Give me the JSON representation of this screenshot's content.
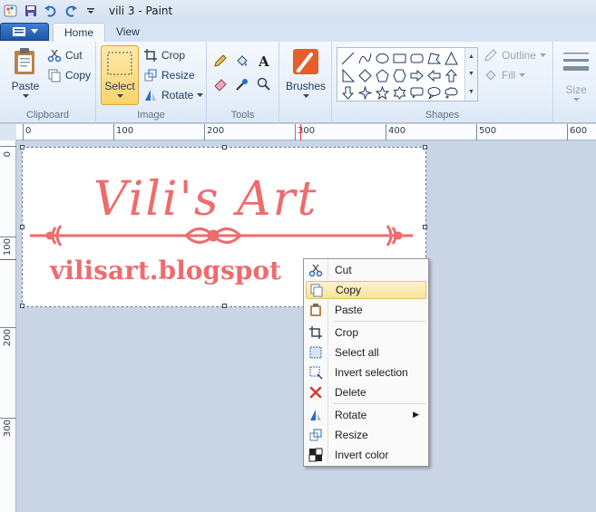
{
  "window": {
    "title": "vili 3 - Paint",
    "qat_icons": [
      "paint-app-icon",
      "save-icon",
      "undo-icon",
      "redo-icon",
      "customize-qat-icon"
    ]
  },
  "tabs": [
    {
      "label": "Home",
      "active": true
    },
    {
      "label": "View",
      "active": false
    }
  ],
  "ribbon": {
    "clipboard": {
      "group_label": "Clipboard",
      "paste_label": "Paste",
      "cut_label": "Cut",
      "copy_label": "Copy"
    },
    "image": {
      "group_label": "Image",
      "select_label": "Select",
      "crop_label": "Crop",
      "resize_label": "Resize",
      "rotate_label": "Rotate"
    },
    "tools": {
      "group_label": "Tools",
      "icons": [
        "pencil-icon",
        "fill-icon",
        "text-icon",
        "eraser-icon",
        "color-picker-icon",
        "magnifier-icon"
      ]
    },
    "brushes": {
      "label": "Brushes"
    },
    "shapes": {
      "group_label": "Shapes",
      "outline_label": "Outline",
      "fill_label": "Fill"
    },
    "size": {
      "label": "Size"
    }
  },
  "ruler": {
    "h_labels": [
      "0",
      "100",
      "200",
      "300",
      "400",
      "500",
      "600"
    ],
    "v_labels": [
      "0",
      "100",
      "200",
      "300"
    ]
  },
  "canvas": {
    "art_title": "Vili's Art",
    "art_url": "vilisart.blogspot",
    "art_color": "#ee6b6e"
  },
  "context_menu": {
    "items": [
      {
        "label": "Cut",
        "icon": "scissors-icon",
        "highlighted": false
      },
      {
        "label": "Copy",
        "icon": "copy-icon",
        "highlighted": true
      },
      {
        "label": "Paste",
        "icon": "paste-icon",
        "highlighted": false
      },
      {
        "label": "Crop",
        "icon": "crop-icon",
        "highlighted": false
      },
      {
        "label": "Select all",
        "icon": "select-all-icon",
        "highlighted": false
      },
      {
        "label": "Invert selection",
        "icon": "invert-selection-icon",
        "highlighted": false
      },
      {
        "label": "Delete",
        "icon": "delete-icon",
        "highlighted": false
      },
      {
        "label": "Rotate",
        "icon": "rotate-icon",
        "highlighted": false,
        "has_submenu": true
      },
      {
        "label": "Resize",
        "icon": "resize-icon",
        "highlighted": false
      },
      {
        "label": "Invert color",
        "icon": "invert-color-icon",
        "highlighted": false
      }
    ]
  },
  "colors": {
    "accent": "#1d56a5",
    "highlight": "#fbd46b",
    "art": "#ee6b6e"
  }
}
